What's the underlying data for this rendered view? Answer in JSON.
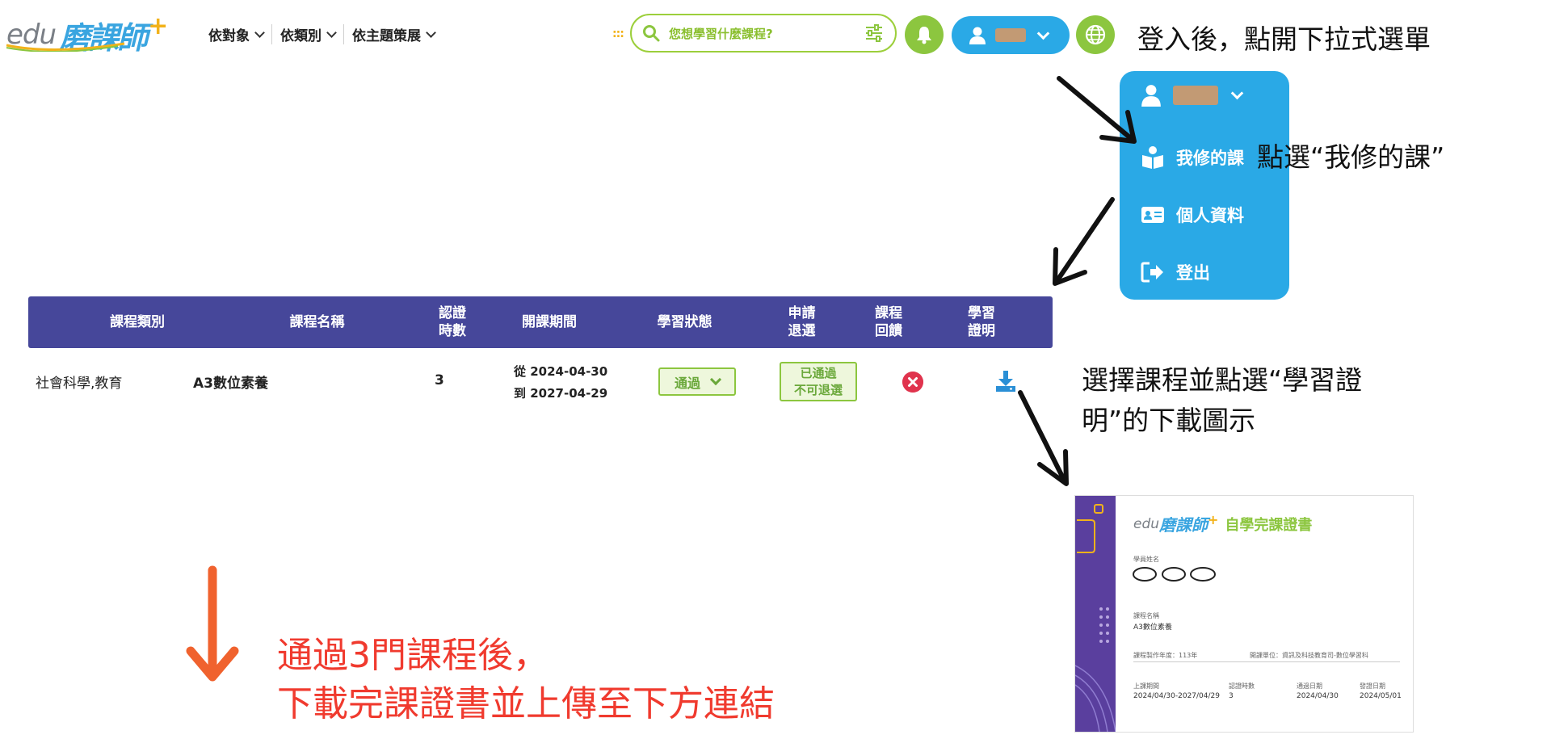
{
  "header": {
    "logo_prefix": "edu",
    "logo_brand": "磨課師",
    "logo_plus": "+",
    "nav": [
      {
        "label": "依對象"
      },
      {
        "label": "依類別"
      },
      {
        "label": "依主題策展"
      }
    ],
    "search_placeholder": "您想學習什麼課程?",
    "icons": [
      "search-icon",
      "filter-icon",
      "bell-icon",
      "user-icon",
      "globe-icon"
    ]
  },
  "annotations": {
    "step1": "登入後，點開下拉式選單",
    "step2": "點選“我修的課”",
    "step3_line1": "選擇課程並點選“學習證",
    "step3_line2": "明”的下載圖示",
    "final_line1": "通過3門課程後，",
    "final_line2": "下載完課證書並上傳至下方連結"
  },
  "dropdown": {
    "items": [
      {
        "label": "我修的課",
        "icon": "book-reader-icon"
      },
      {
        "label": "個人資料",
        "icon": "id-card-icon"
      },
      {
        "label": "登出",
        "icon": "logout-icon"
      }
    ]
  },
  "table": {
    "headers": [
      {
        "line1": "課程類別",
        "line2": ""
      },
      {
        "line1": "課程名稱",
        "line2": ""
      },
      {
        "line1": "認證",
        "line2": "時數"
      },
      {
        "line1": "開課期間",
        "line2": ""
      },
      {
        "line1": "學習狀態",
        "line2": ""
      },
      {
        "line1": "申請",
        "line2": "退選"
      },
      {
        "line1": "課程",
        "line2": "回饋"
      },
      {
        "line1": "學習",
        "line2": "證明"
      }
    ],
    "rows": [
      {
        "category": "社會科學,教育",
        "name": "A3數位素養",
        "hours": "3",
        "period_from": "從 2024-04-30",
        "period_to": "到 2027-04-29",
        "status": "通過",
        "drop_line1": "已通過",
        "drop_line2": "不可退選"
      }
    ]
  },
  "certificate": {
    "logo_prefix": "edu",
    "logo_brand": "磨課師",
    "title": "自學完課證書",
    "student_label": "學員姓名",
    "course_label": "課程名稱",
    "course_value": "A3數位素養",
    "year_label": "課程製作年度：113年",
    "unit_label": "開課單位：資訊及科技教育司-數位學習科",
    "period_label": "上課期間",
    "period_value": "2024/04/30-2027/04/29",
    "hours_label": "認證時數",
    "hours_value": "3",
    "pass_label": "通過日期",
    "pass_value": "2024/04/30",
    "issue_label": "發證日期",
    "issue_value": "2024/05/01"
  },
  "colors": {
    "brand_blue": "#2aa9e6",
    "brand_green": "#8cc63f",
    "table_header": "#46479a",
    "annotation_red": "#f03a2e",
    "arrow_orange": "#f0622e"
  }
}
